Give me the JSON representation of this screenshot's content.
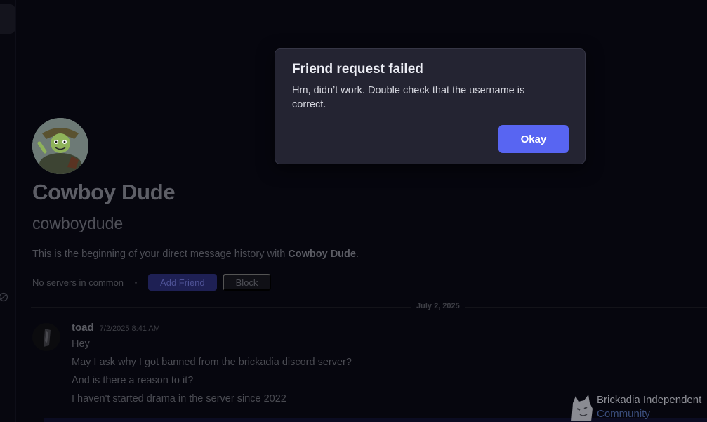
{
  "dm": {
    "display_name": "Cowboy Dude",
    "username": "cowboydude",
    "intro_prefix": "This is the beginning of your direct message history with ",
    "intro_name": "Cowboy Dude",
    "intro_suffix": ".",
    "mutual_servers": "No servers in common",
    "add_friend_label": "Add Friend",
    "block_label": "Block"
  },
  "date_divider": "July 2, 2025",
  "message": {
    "author": "toad",
    "timestamp": "7/2/2025 8:41 AM",
    "lines": [
      "Hey",
      "May I ask why I got banned from the brickadia discord server?",
      "And is there a reason to it?",
      "I haven't started drama in the server since 2022"
    ]
  },
  "modal": {
    "title": "Friend request failed",
    "body": "Hm, didn’t work. Double check that the username is correct.",
    "confirm_label": "Okay"
  },
  "watermark": {
    "line1": "Brickadia Independent",
    "line2": "Community"
  },
  "colors": {
    "background": "#06060e",
    "modal_bg": "#242432",
    "accent": "#5865f2",
    "watermark_link": "#3a4d7c"
  },
  "icons": {
    "left_rail": "blocked-circle-icon",
    "watermark": "wolf-logo-icon"
  }
}
